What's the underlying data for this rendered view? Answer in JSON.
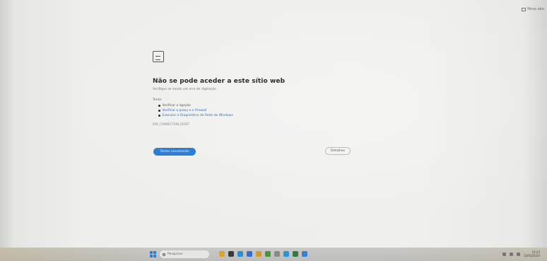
{
  "window": {
    "corner_button_label": "Nova aba"
  },
  "error_page": {
    "title": "Não se pode aceder a este sítio web",
    "subtitle": "Verifique se existe um erro de digitação",
    "try_label": "Tente:",
    "suggestions": [
      {
        "label": "Verificar a ligação",
        "is_link": false
      },
      {
        "label": "Verificar o proxy e a firewall",
        "is_link": true
      },
      {
        "label": "Executar o Diagnóstico de Rede do Windows",
        "is_link": true
      }
    ],
    "error_code": "ERR_CONNECTION_RESET",
    "primary_button": "Tentar novamente",
    "secondary_button": "Detalhes"
  },
  "taskbar": {
    "search_placeholder": "Pesquisar",
    "apps": [
      {
        "name": "folder-icon",
        "color": "#d9a23a"
      },
      {
        "name": "terminal-icon",
        "color": "#3a3a3a"
      },
      {
        "name": "edge-icon",
        "color": "#2b8fd6"
      },
      {
        "name": "store-icon",
        "color": "#2f6fd1"
      },
      {
        "name": "app-icon",
        "color": "#d39b2c"
      },
      {
        "name": "chrome-icon",
        "color": "#4f8f3f"
      },
      {
        "name": "settings-icon",
        "color": "#8a8a8a"
      },
      {
        "name": "app-icon-2",
        "color": "#2f8fd8"
      },
      {
        "name": "excel-icon",
        "color": "#2e7d3e"
      },
      {
        "name": "app-icon-3",
        "color": "#3a7fd0"
      }
    ],
    "clock_time": "10:23",
    "clock_date": "12/03/2024"
  }
}
